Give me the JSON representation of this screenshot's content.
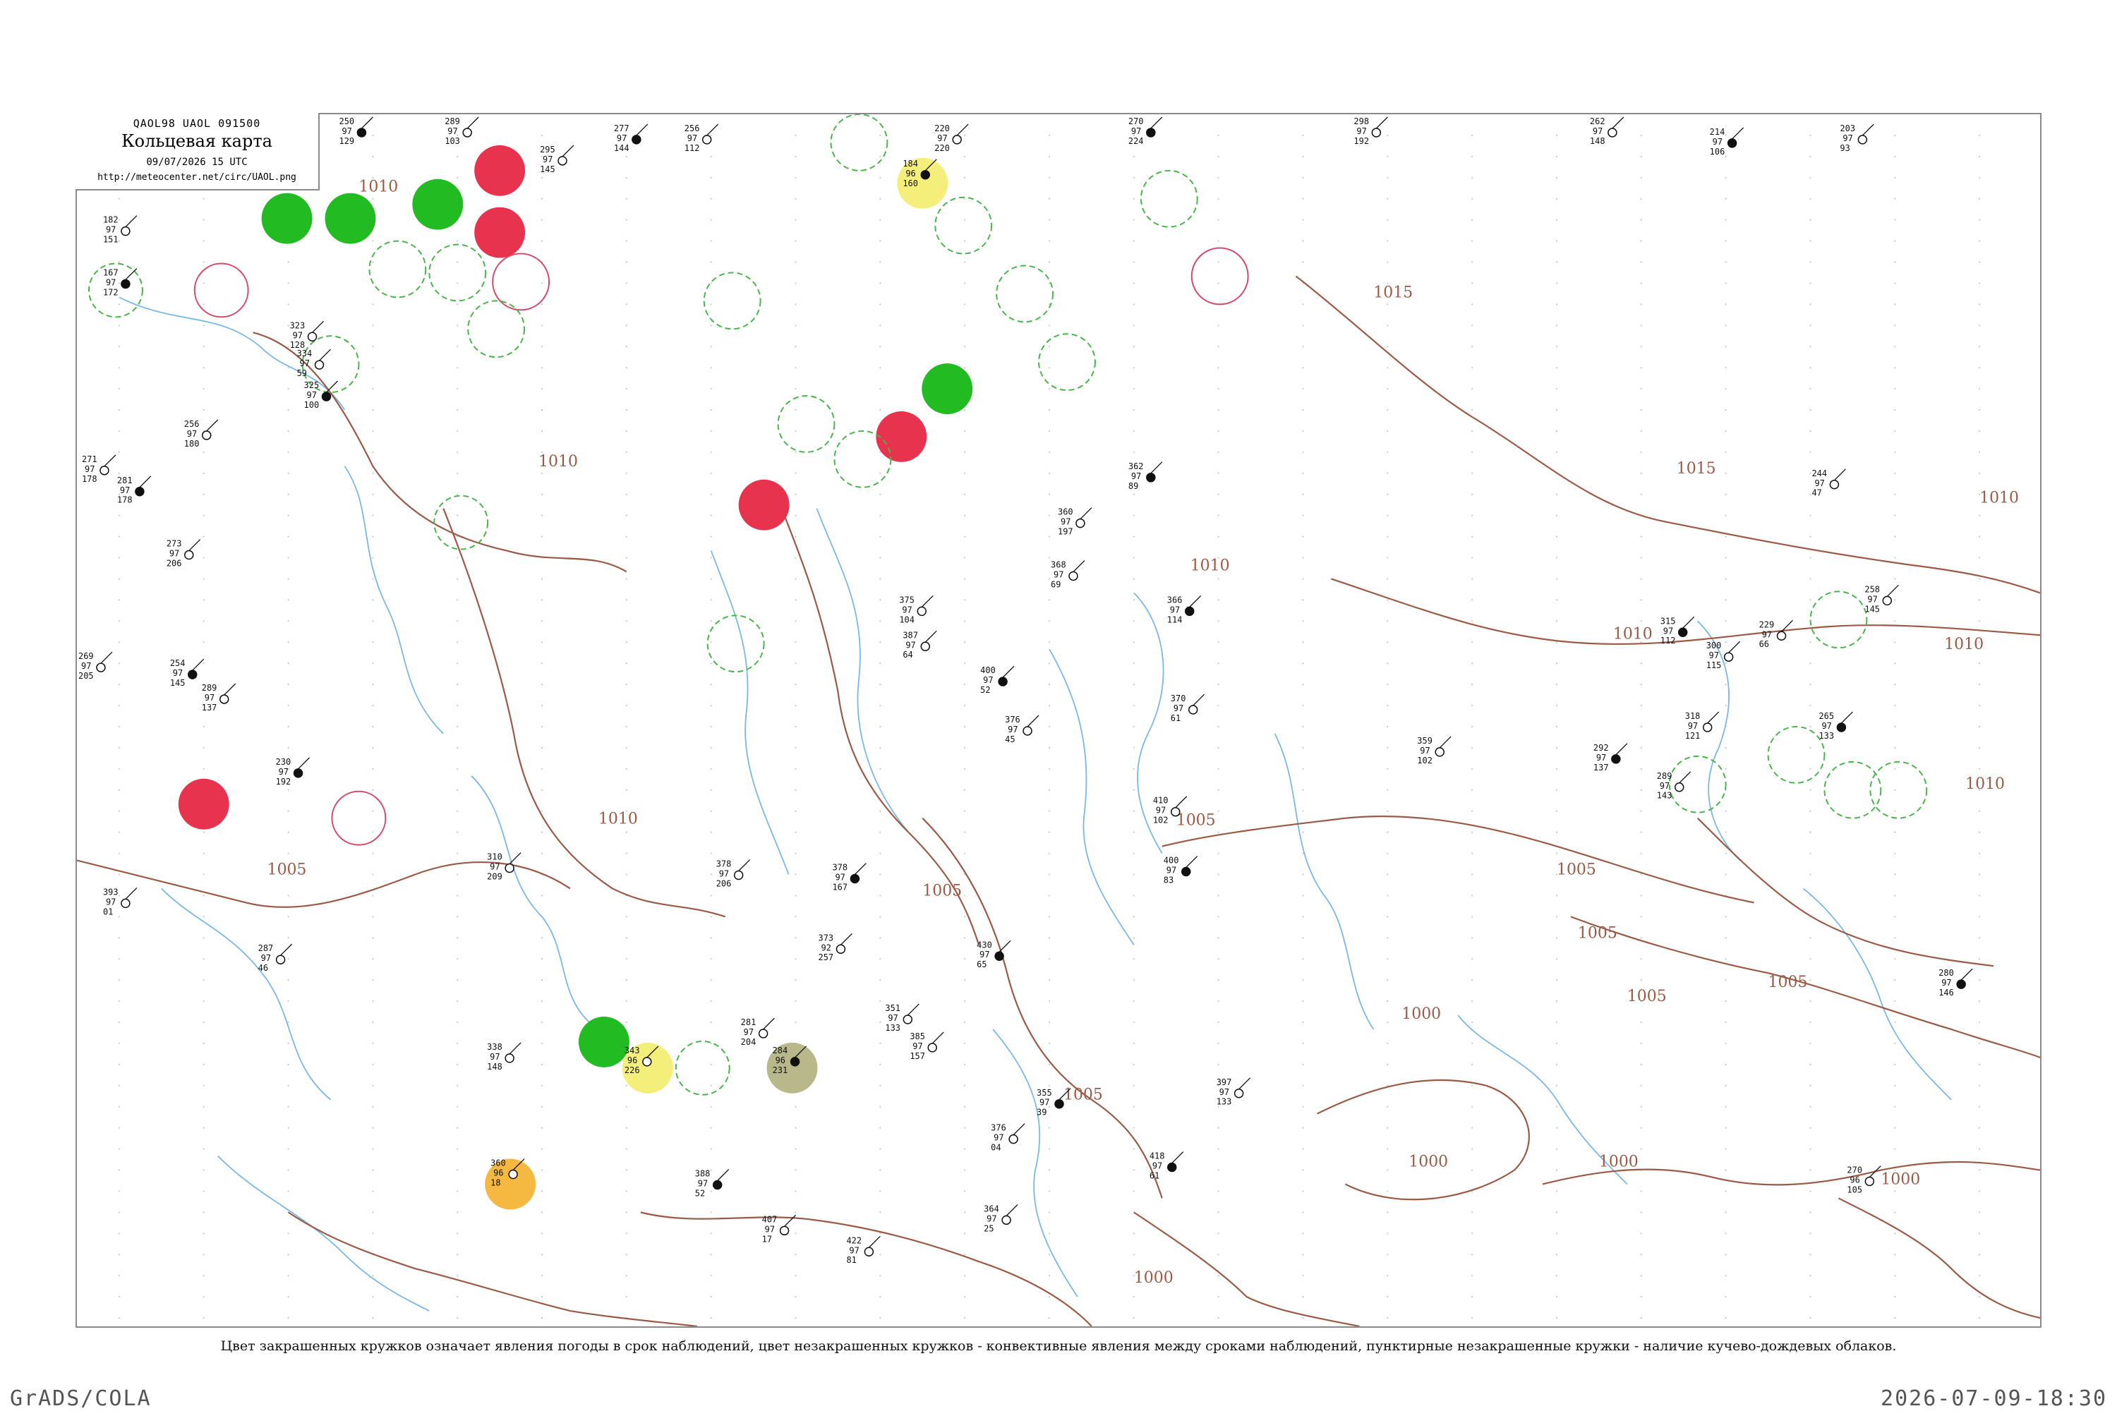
{
  "title": {
    "code": "QAOL98  UAOL  091500",
    "name": "Кольцевая карта",
    "time": "09/07/2026 15 UTC",
    "url": "http://meteocenter.net/circ/UAOL.png"
  },
  "legend_note": "Цвет закрашенных кружков означает явления погоды в срок наблюдений, цвет незакрашенных кружков - конвективные явления между сроками наблюдений, пунктирные незакрашенные кружки - наличие кучево-дождевых облаков.",
  "footer": {
    "left": "GrADS/COLA",
    "right": "2026-07-09-18:30"
  },
  "colors": {
    "isobar": "#9b5a45",
    "river": "#7ab8e6",
    "thunder_fill": "#22bb22",
    "rain_fill": "#e8334f",
    "haze_fill": "#f3ef7a",
    "dust_fill": "#b8b88a",
    "smoke_fill": "#f5b841",
    "cb_dashed": "#4ab54a",
    "convective_outline": "#d64a6a"
  },
  "isobar_labels": [
    "1010",
    "1015",
    "1010",
    "1010",
    "1015",
    "1010",
    "1010",
    "1010",
    "1010",
    "1010",
    "1005",
    "1005",
    "1005",
    "1005",
    "1005",
    "1005",
    "1005",
    "1005",
    "1000",
    "1000",
    "1000",
    "1000",
    "1000"
  ],
  "stations": [
    {
      "id": "s1",
      "nums": [
        "250",
        "97",
        "129"
      ]
    },
    {
      "id": "s2",
      "nums": [
        "289",
        "97",
        "103"
      ]
    },
    {
      "id": "s3",
      "nums": [
        "295",
        "97",
        "145"
      ]
    },
    {
      "id": "s4",
      "nums": [
        "277",
        "97",
        "144"
      ]
    },
    {
      "id": "s5",
      "nums": [
        "256",
        "97",
        "112"
      ]
    },
    {
      "id": "s6",
      "nums": [
        "220",
        "97",
        "220"
      ]
    },
    {
      "id": "s7",
      "nums": [
        "270",
        "97",
        "224"
      ]
    },
    {
      "id": "s8",
      "nums": [
        "298",
        "97",
        "192"
      ]
    },
    {
      "id": "s9",
      "nums": [
        "262",
        "97",
        "148"
      ]
    },
    {
      "id": "s10",
      "nums": [
        "214",
        "97",
        "106"
      ]
    },
    {
      "id": "s11",
      "nums": [
        "203",
        "97",
        "93"
      ]
    },
    {
      "id": "s12",
      "nums": [
        "182",
        "97",
        "151"
      ]
    },
    {
      "id": "s13",
      "nums": [
        "167",
        "97",
        "172"
      ]
    },
    {
      "id": "s14",
      "nums": [
        "323",
        "97",
        "128"
      ]
    },
    {
      "id": "s15",
      "nums": [
        "334",
        "97",
        "59"
      ]
    },
    {
      "id": "s16",
      "nums": [
        "325",
        "97",
        "100"
      ]
    },
    {
      "id": "s17",
      "nums": [
        "256",
        "97",
        "180"
      ]
    },
    {
      "id": "s18",
      "nums": [
        "271",
        "97",
        "178"
      ]
    },
    {
      "id": "s19",
      "nums": [
        "281",
        "97",
        "178"
      ]
    },
    {
      "id": "s20",
      "nums": [
        "273",
        "97",
        "206"
      ]
    },
    {
      "id": "s21",
      "nums": [
        "269",
        "97",
        "205"
      ]
    },
    {
      "id": "s22",
      "nums": [
        "254",
        "97",
        "145"
      ]
    },
    {
      "id": "s23",
      "nums": [
        "289",
        "97",
        "137"
      ]
    },
    {
      "id": "s24",
      "nums": [
        "393",
        "97",
        "01"
      ]
    },
    {
      "id": "s25",
      "nums": [
        "230",
        "97",
        "192"
      ]
    },
    {
      "id": "s26",
      "nums": [
        "310",
        "97",
        "209"
      ]
    },
    {
      "id": "s27",
      "nums": [
        "287",
        "97",
        "46"
      ]
    },
    {
      "id": "s28",
      "nums": [
        "362",
        "97",
        "89"
      ]
    },
    {
      "id": "s29",
      "nums": [
        "360",
        "97",
        "197"
      ]
    },
    {
      "id": "s30",
      "nums": [
        "368",
        "97",
        "69"
      ]
    },
    {
      "id": "s31",
      "nums": [
        "366",
        "97",
        "114"
      ]
    },
    {
      "id": "s32",
      "nums": [
        "370",
        "97",
        "61"
      ]
    },
    {
      "id": "s33",
      "nums": [
        "410",
        "97",
        "102"
      ]
    },
    {
      "id": "s34",
      "nums": [
        "400",
        "97",
        "83"
      ]
    },
    {
      "id": "s35",
      "nums": [
        "375",
        "97",
        "104"
      ]
    },
    {
      "id": "s36",
      "nums": [
        "387",
        "97",
        "64"
      ]
    },
    {
      "id": "s37",
      "nums": [
        "400",
        "97",
        "52"
      ]
    },
    {
      "id": "s38",
      "nums": [
        "376",
        "97",
        "45"
      ]
    },
    {
      "id": "s39",
      "nums": [
        "373",
        "92",
        "257"
      ]
    },
    {
      "id": "s40",
      "nums": [
        "430",
        "97",
        "65"
      ]
    },
    {
      "id": "s41",
      "nums": [
        "351",
        "97",
        "133"
      ]
    },
    {
      "id": "s42",
      "nums": [
        "385",
        "97",
        "157"
      ]
    },
    {
      "id": "s43",
      "nums": [
        "378",
        "97",
        "167"
      ]
    },
    {
      "id": "s44",
      "nums": [
        "378",
        "97",
        "206"
      ]
    },
    {
      "id": "s45",
      "nums": [
        "359",
        "97",
        "102"
      ]
    },
    {
      "id": "s46",
      "nums": [
        "292",
        "97",
        "137"
      ]
    },
    {
      "id": "s47",
      "nums": [
        "289",
        "97",
        "143"
      ]
    },
    {
      "id": "s48",
      "nums": [
        "318",
        "97",
        "121"
      ]
    },
    {
      "id": "s49",
      "nums": [
        "265",
        "97",
        "133"
      ]
    },
    {
      "id": "s50",
      "nums": [
        "229",
        "97",
        "66"
      ]
    },
    {
      "id": "s51",
      "nums": [
        "244",
        "97",
        "47"
      ]
    },
    {
      "id": "s52",
      "nums": [
        "280",
        "97",
        "146"
      ]
    },
    {
      "id": "s53",
      "nums": [
        "270",
        "96",
        "105"
      ]
    },
    {
      "id": "s54",
      "nums": [
        "397",
        "97",
        "133"
      ]
    },
    {
      "id": "s55",
      "nums": [
        "418",
        "97",
        "61"
      ]
    },
    {
      "id": "s56",
      "nums": [
        "422",
        "97",
        "81"
      ]
    },
    {
      "id": "s57",
      "nums": [
        "407",
        "97",
        "17"
      ]
    },
    {
      "id": "s58",
      "nums": [
        "388",
        "97",
        "52"
      ]
    },
    {
      "id": "s59",
      "nums": [
        "364",
        "97",
        "25"
      ]
    },
    {
      "id": "s60",
      "nums": [
        "376",
        "97",
        "04"
      ]
    },
    {
      "id": "s61",
      "nums": [
        "355",
        "97",
        "39"
      ]
    },
    {
      "id": "s62",
      "nums": [
        "338",
        "97",
        "148"
      ]
    },
    {
      "id": "s63",
      "nums": [
        "281",
        "97",
        "204"
      ]
    },
    {
      "id": "s64",
      "nums": [
        "284",
        "96",
        "231"
      ]
    },
    {
      "id": "s65",
      "nums": [
        "343",
        "96",
        "226"
      ]
    },
    {
      "id": "s66",
      "nums": [
        "360",
        "96",
        "18"
      ]
    },
    {
      "id": "s67",
      "nums": [
        "184",
        "96",
        "160"
      ]
    },
    {
      "id": "s68",
      "nums": [
        "258",
        "97",
        "145"
      ]
    },
    {
      "id": "s69",
      "nums": [
        "300",
        "97",
        "115"
      ]
    },
    {
      "id": "s70",
      "nums": [
        "315",
        "97",
        "112"
      ]
    }
  ]
}
